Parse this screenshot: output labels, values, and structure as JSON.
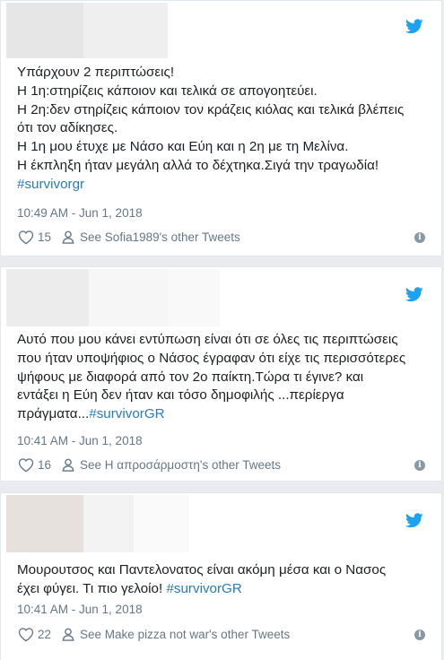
{
  "colors": {
    "accent": "#1da1f2",
    "link": "#2b7bb9",
    "muted": "#657786",
    "background": "#e9ebee"
  },
  "tweets": [
    {
      "lines": [
        "Υπάρχουν 2 περιπτώσεις!",
        "Η 1η:στηρίζεις κάποιον και τελικά σε απογοητεύει.",
        "Η 2η:δεν στηρίζεις κάποιον τον κράζεις κιόλας και τελικά βλέπεις",
        "ότι τον αδίκησες.",
        "Η 1η μου έτυχε με Νάσο και Εύη και η 2η με τη Μελίνα.",
        "Η έκπληξη ήταν μεγάλη αλλά το δέχτηκα.Σιγά την τραγωδία!"
      ],
      "hashtag": "#survivorgr",
      "timestamp": "10:49 AM - Jun 1, 2018",
      "likes": "15",
      "other_tweets": "See Sofia1989's other Tweets"
    },
    {
      "lines": [
        "Αυτό που μου κάνει εντύπωση είναι ότι σε όλες τις περιπτώσεις",
        "που ήταν υποψήφιος ο Νάσος έγραφαν ότι είχε τις περισσότερες",
        "ψήφους με διαφορά από τον 2ο παίκτη.Τώρα τι έγινε? και",
        "εντάξει η Εύη δεν ήταν και τόσο δημοφιλής ...περίεργα",
        "πράγματα..."
      ],
      "hashtag": "#survivorGR",
      "timestamp": "10:41 AM - Jun 1, 2018",
      "likes": "16",
      "other_tweets": "See Η απροσάρμοστη's other Tweets"
    },
    {
      "lines": [
        "Μουρουτσος και Παντελονατος είναι ακόμη μέσα και ο Νασος",
        "έχει φύγει. Τι πιο γελοίο! "
      ],
      "hashtag": "#survivorGR",
      "timestamp": "10:41 AM - Jun 1, 2018",
      "likes": "22",
      "other_tweets": "See Make pizza not war's other Tweets"
    }
  ]
}
